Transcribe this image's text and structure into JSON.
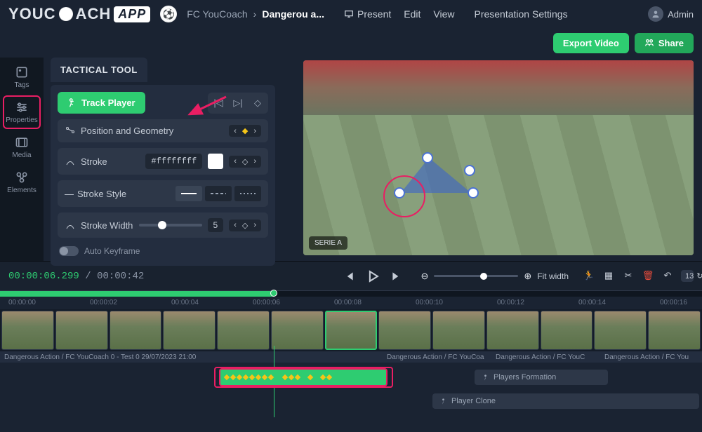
{
  "header": {
    "logo_pre": "YOUC",
    "logo_post": "ACH",
    "logo_app": "APP",
    "breadcrumb_team": "FC YouCoach",
    "breadcrumb_current": "Dangerou a...",
    "menu": {
      "present": "Present",
      "edit": "Edit",
      "view": "View",
      "settings": "Presentation Settings"
    },
    "user": "Admin"
  },
  "actions": {
    "export": "Export Video",
    "share": "Share"
  },
  "sidebar": {
    "items": [
      {
        "label": "Tags"
      },
      {
        "label": "Properties"
      },
      {
        "label": "Media"
      },
      {
        "label": "Elements"
      }
    ]
  },
  "panel": {
    "title": "TACTICAL TOOL",
    "track_button": "Track Player",
    "position": "Position and Geometry",
    "stroke_label": "Stroke",
    "stroke_value": "#ffffffff",
    "stroke_style_label": "Stroke Style",
    "stroke_width_label": "Stroke Width",
    "stroke_width_value": "5",
    "auto_keyframe": "Auto Keyframe"
  },
  "video": {
    "badge": "SERIE A"
  },
  "timeline": {
    "current_pre": "00:00:",
    "current_post": "06.299",
    "total": "00:00:42",
    "fit_width": "Fit width",
    "undo_count": "13",
    "ruler": [
      "00:00:00",
      "00:00:02",
      "00:00:04",
      "00:00:06",
      "00:00:08",
      "00:00:10",
      "00:00:12",
      "00:00:14",
      "00:00:16"
    ],
    "clip_label": "Dangerous Action / FC YouCoach 0 - Test 0 29/07/2023 21:00",
    "clip_label_short": "Dangerous Action / FC YouCoa",
    "clip_label_short2": "Dangerous Action / FC YouC",
    "clip_label_short3": "Dangerous Action / FC You",
    "tracks": {
      "formation": "Players Formation",
      "clone": "Player Clone"
    }
  }
}
